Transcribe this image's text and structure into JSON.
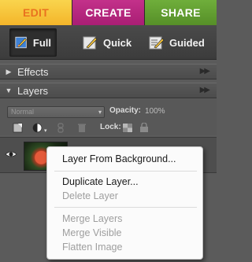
{
  "tabs": [
    {
      "label": "EDIT",
      "color": "#f4b52a"
    },
    {
      "label": "CREATE",
      "color": "#a91e74"
    },
    {
      "label": "SHARE",
      "color": "#568f28"
    }
  ],
  "modes": {
    "full": "Full",
    "quick": "Quick",
    "guided": "Guided",
    "selected": "Full"
  },
  "panels": {
    "effects": {
      "title": "Effects",
      "expanded": false
    },
    "layers": {
      "title": "Layers",
      "expanded": true
    }
  },
  "layers_toolbar": {
    "blend_mode": "Normal",
    "opacity_label": "Opacity:",
    "opacity_value": "100%",
    "lock_label": "Lock:",
    "icons": [
      "new-layer-icon",
      "adjustment-layer-icon",
      "link-icon",
      "delete-layer-icon",
      "lock-pixels-icon",
      "lock-all-icon"
    ]
  },
  "layer": {
    "visible": true,
    "thumbnail": "flower-photo"
  },
  "context_menu": {
    "items": [
      {
        "label": "Layer From Background...",
        "enabled": true
      },
      {
        "label": "Duplicate Layer...",
        "enabled": true
      },
      {
        "label": "Delete Layer",
        "enabled": false
      },
      {
        "label": "Merge Layers",
        "enabled": false
      },
      {
        "label": "Merge Visible",
        "enabled": false
      },
      {
        "label": "Flatten Image",
        "enabled": false
      }
    ]
  }
}
